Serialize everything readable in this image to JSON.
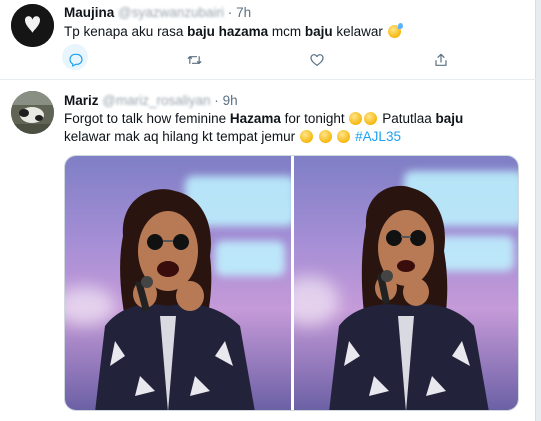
{
  "tweet1": {
    "name": "Maujina",
    "handle": "@syazwanzubairi",
    "time": "7h",
    "text_before": "Tp kenapa aku rasa ",
    "bold_text": "baju hazama",
    "text_middle": " mcm ",
    "bold_text2": "baju",
    "text_after": " kelawar",
    "emoji": "sweat-smile-emoji"
  },
  "tweet2": {
    "name": "Mariz",
    "handle": "@mariz_rosaliyan",
    "time": "9h",
    "line1_before": "Forgot to talk how feminine ",
    "line1_bold": "Hazama",
    "line1_after": " for tonight",
    "line2_before": "Patutlaa ",
    "line2_bold": "baju",
    "line3_text": "kelawar mak aq hilang kt tempat jemur",
    "hashtag": "#AJL35"
  },
  "actions": {
    "reply_icon": "reply-icon",
    "retweet_icon": "retweet-icon",
    "like_icon": "like-icon",
    "share_icon": "share-icon"
  },
  "colors": {
    "accent": "#1da1f2",
    "text": "#0f1419",
    "secondary": "#5b7083",
    "border": "#e6ecf0"
  }
}
